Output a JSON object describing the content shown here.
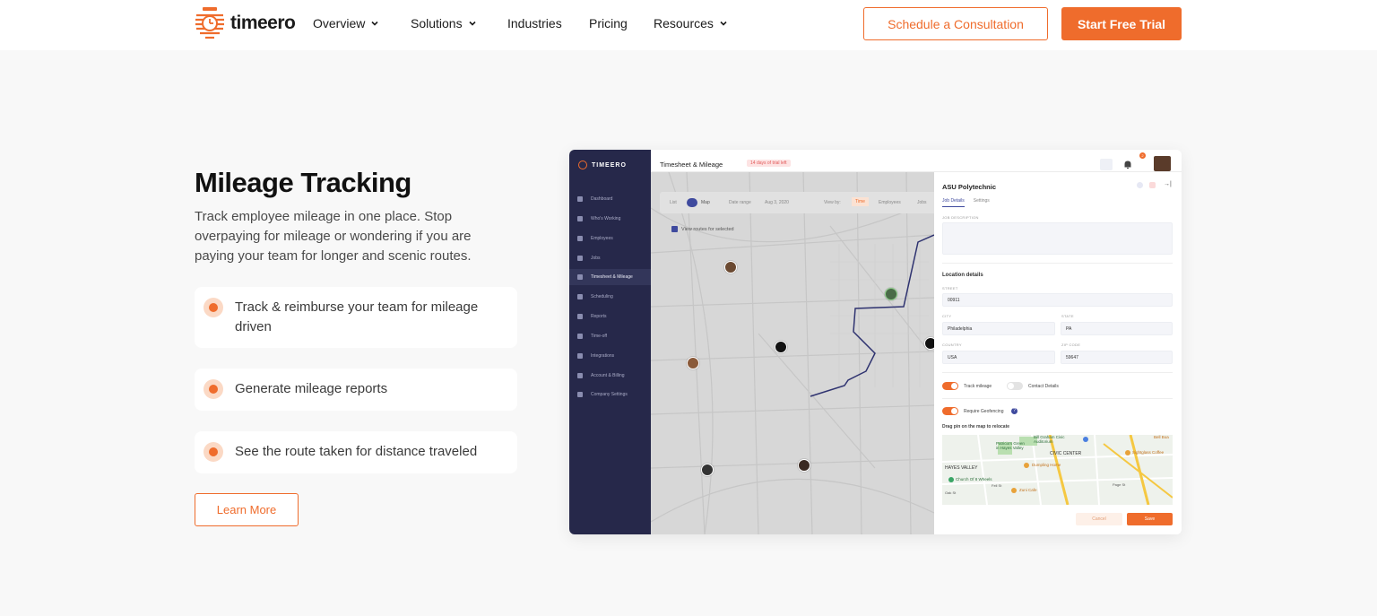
{
  "brand": {
    "name": "timeero",
    "accent": "#ef6c2c"
  },
  "nav": {
    "items": [
      {
        "label": "Overview",
        "dropdown": true
      },
      {
        "label": "Solutions",
        "dropdown": true
      },
      {
        "label": "Industries",
        "dropdown": false
      },
      {
        "label": "Pricing",
        "dropdown": false
      },
      {
        "label": "Resources",
        "dropdown": true
      }
    ],
    "consult_label": "Schedule a Consultation",
    "trial_label": "Start Free Trial"
  },
  "hero": {
    "title": "Mileage Tracking",
    "description": "Track employee mileage in one place. Stop overpaying for mileage or wondering if you are paying your team for longer and scenic routes.",
    "features": [
      "Track & reimburse your team for mileage driven",
      "Generate mileage reports",
      "See the route taken for distance traveled"
    ],
    "learn_more": "Learn More"
  },
  "app": {
    "brand": "TIMEERO",
    "sidebar": [
      "Dashboard",
      "Who's Working",
      "Employees",
      "Jobs",
      "Timesheet & Mileage",
      "Scheduling",
      "Reports",
      "Time-off",
      "Integrations",
      "Account & Billing",
      "Company Settings"
    ],
    "page_title": "Timesheet & Mileage",
    "trial_badge": "14 days of trial left",
    "notification_count": "2",
    "map_controls": {
      "list": "List",
      "map": "Map",
      "date_range": "Date range",
      "date": "Aug 3, 2020",
      "view_by": "View by:",
      "time": "Time",
      "employees": "Employees",
      "jobs": "Jobs",
      "view_routes": "View routes for selected"
    },
    "panel": {
      "title": "ASU Polytechnic",
      "tabs": [
        "Job Details",
        "Settings"
      ],
      "job_description_label": "JOB DESCRIPTION",
      "location_heading": "Location details",
      "street_label": "STREET",
      "street_value": "00911",
      "city_label": "CITY",
      "city_value": "Philadelphia",
      "state_label": "STATE",
      "state_value": "PA",
      "country_label": "COUNTRY",
      "country_value": "USA",
      "zip_label": "ZIP CODE",
      "zip_value": "59647",
      "track_mileage": "Track mileage",
      "contact_details": "Contact Details",
      "require_geofencing": "Require Geofencing",
      "drag_pin": "Drag pin on the map to relocate",
      "map_labels": [
        "Bill Graham Civic Auditorium",
        "Patricia's Green in Hayes Valley",
        "CIVIC CENTER",
        "HAYES VALLEY",
        "Dumpling Home",
        "Church Of 8 Wheels",
        "Zuni Cafe",
        "Sightglass Coffee",
        "Bell Boa",
        "Oak St",
        "Fell St",
        "Page St"
      ],
      "cancel": "Cancel",
      "save": "Save"
    }
  }
}
